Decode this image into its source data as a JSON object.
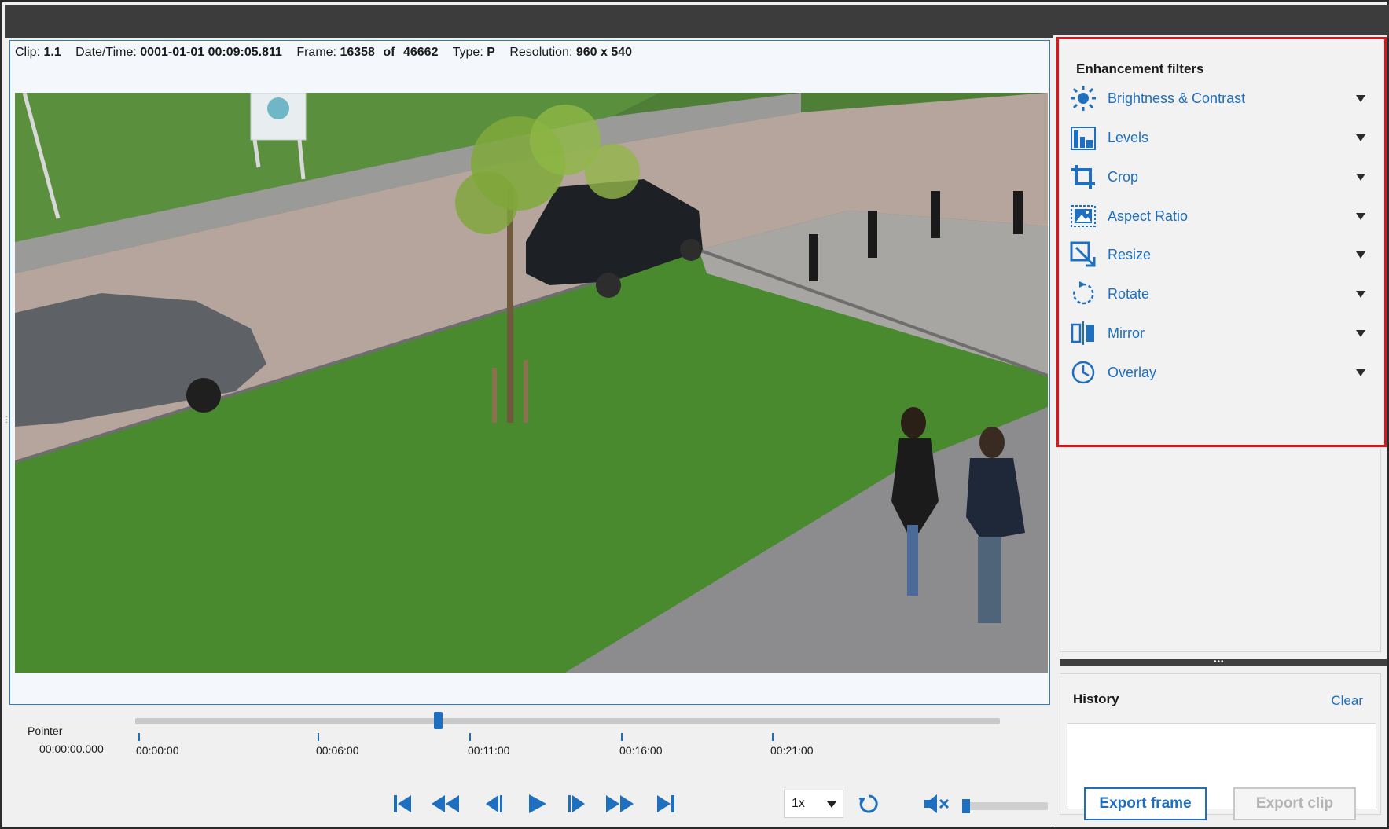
{
  "info_bar": {
    "clip_label": "Clip:",
    "clip_value": "1.1",
    "datetime_label": "Date/Time:",
    "datetime_value": "0001-01-01 00:09:05.811",
    "frame_label": "Frame:",
    "frame_value": "16358",
    "frame_of_label": "of",
    "frame_total": "46662",
    "type_label": "Type:",
    "type_value": "P",
    "resolution_label": "Resolution:",
    "resolution_value": "960 x 540"
  },
  "timeline": {
    "pointer_label": "Pointer",
    "pointer_value": "00:00:00.000",
    "playhead_fraction": 0.35,
    "ticks": [
      "00:00:00",
      "00:06:00",
      "00:11:00",
      "00:16:00",
      "00:21:00"
    ]
  },
  "playback": {
    "speed_value": "1x",
    "volume_fraction": 0.0,
    "icons": [
      "skip-to-start-icon",
      "fast-rewind-icon",
      "step-back-icon",
      "play-icon",
      "step-forward-icon",
      "fast-forward-icon",
      "skip-to-end-icon",
      "loop-icon",
      "mute-icon"
    ]
  },
  "filters": {
    "title": "Enhancement filters",
    "items": [
      {
        "label": "Brightness & Contrast",
        "icon": "brightness-icon"
      },
      {
        "label": "Levels",
        "icon": "levels-icon"
      },
      {
        "label": "Crop",
        "icon": "crop-icon"
      },
      {
        "label": "Aspect Ratio",
        "icon": "aspect-ratio-icon"
      },
      {
        "label": "Resize",
        "icon": "resize-icon"
      },
      {
        "label": "Rotate",
        "icon": "rotate-icon"
      },
      {
        "label": "Mirror",
        "icon": "mirror-icon"
      },
      {
        "label": "Overlay",
        "icon": "overlay-icon"
      }
    ]
  },
  "history": {
    "title": "History",
    "clear_label": "Clear"
  },
  "actions": {
    "export_frame_label": "Export frame",
    "export_clip_label": "Export clip"
  },
  "colors": {
    "accent": "#1e6fbf",
    "highlight_border": "#e0131a",
    "title_bar": "#3c3c3c"
  }
}
